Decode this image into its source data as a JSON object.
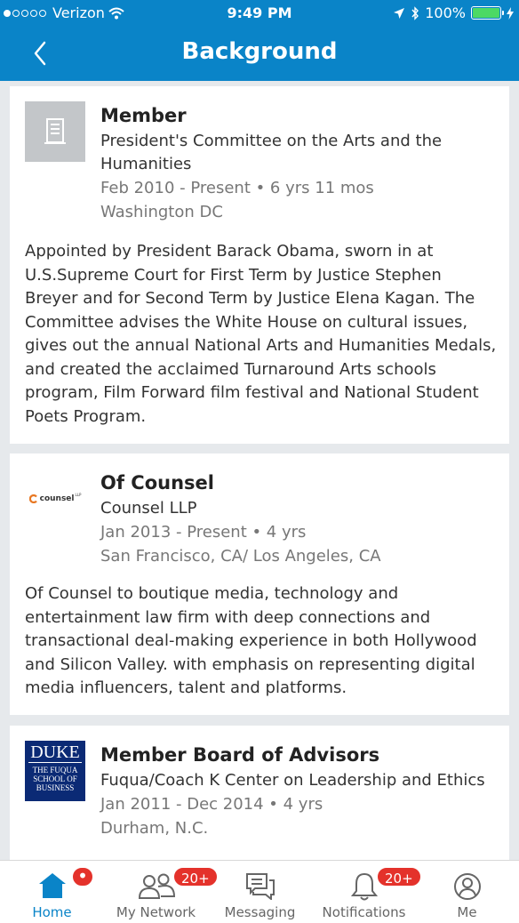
{
  "status": {
    "carrier": "Verizon",
    "time": "9:49 PM",
    "battery": "100%"
  },
  "nav": {
    "title": "Background"
  },
  "positions": [
    {
      "role": "Member",
      "org": "President's Committee on the Arts and the Humanities",
      "dates": "Feb 2010 - Present • 6 yrs 11 mos",
      "location": "Washington DC",
      "description": "Appointed by President Barack Obama, sworn in at U.S.Supreme Court for First Term by Justice Stephen Breyer and for Second Term by Justice Elena Kagan. The Committee advises the White House on cultural issues, gives out the annual National Arts and Humanities Medals, and created the acclaimed Turnaround Arts schools program, Film Forward film festival and National Student Poets Program.",
      "logo_icon": "building-icon"
    },
    {
      "role": "Of Counsel",
      "org": "Counsel LLP",
      "dates": "Jan 2013 - Present • 4 yrs",
      "location": "San Francisco, CA/ Los Angeles, CA",
      "description": "Of Counsel to boutique media, technology and entertainment law firm with deep connections and transactional deal-making experience in both Hollywood and Silicon Valley. with emphasis on representing digital media influencers, talent and platforms.",
      "logo_text": "counsel",
      "logo_suffix": "LLP"
    },
    {
      "role": "Member Board of Advisors",
      "org": "Fuqua/Coach K Center on Leadership and Ethics",
      "dates": "Jan 2011 - Dec 2014 • 4 yrs",
      "location": "Durham, N.C.",
      "logo_title": "DUKE",
      "logo_subtitle": "THE FUQUA SCHOOL OF BUSINESS"
    }
  ],
  "tabbar": {
    "tabs": [
      {
        "label": "Home",
        "icon": "home-icon",
        "active": true,
        "badge": "•"
      },
      {
        "label": "My Network",
        "icon": "network-icon",
        "badge": "20+"
      },
      {
        "label": "Messaging",
        "icon": "messaging-icon"
      },
      {
        "label": "Notifications",
        "icon": "bell-icon",
        "badge": "20+"
      },
      {
        "label": "Me",
        "icon": "profile-icon"
      }
    ]
  },
  "colors": {
    "brand": "#0a84c8",
    "badge": "#e4322b",
    "battery": "#4cd964"
  }
}
